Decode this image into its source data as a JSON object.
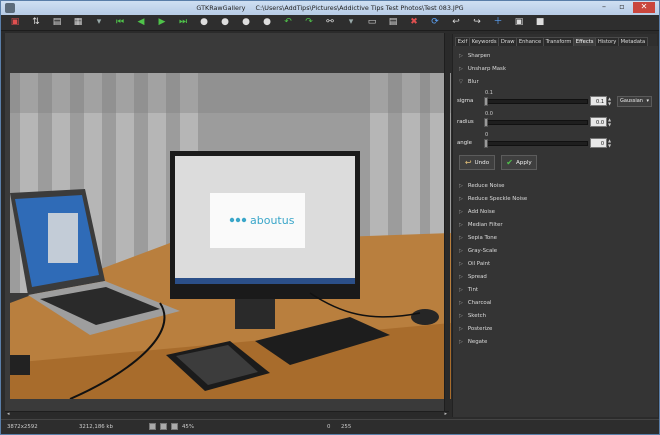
{
  "window": {
    "app_name": "GTKRawGallery",
    "file_path": "C:\\Users\\AddTips\\Pictures\\Addictive Tips Test Photos\\Test 083.JPG"
  },
  "toolbar": {
    "icons": [
      "photo-icon",
      "sort-icon",
      "print-icon",
      "layout-icon",
      "dropdown-icon",
      "first-icon",
      "prev-icon",
      "next-icon",
      "last-icon",
      "dot-icon",
      "dot-icon",
      "dot-icon",
      "dot-icon",
      "rotate-left-icon",
      "rotate-right-icon",
      "link-icon",
      "dropdown-icon",
      "page-icon",
      "doc-icon",
      "delete-icon",
      "refresh-icon",
      "undo-icon",
      "redo-icon",
      "add-icon",
      "image-icon",
      "stop-icon"
    ]
  },
  "photo": {
    "monitor_text": "aboutus"
  },
  "tabs": [
    "Exif",
    "Keywords",
    "Draw",
    "Enhance",
    "Transform",
    "Effects",
    "History",
    "Metadata"
  ],
  "active_tab": "Effects",
  "effects_top": [
    "Sharpen",
    "Unsharp Mask"
  ],
  "blur": {
    "label": "Blur",
    "sigma": {
      "label": "sigma",
      "value_above": "0.1",
      "value": "0.1"
    },
    "radius": {
      "label": "radius",
      "value_above": "0.0",
      "value": "0.0"
    },
    "angle": {
      "label": "angle",
      "value_above": "0",
      "value": "0"
    },
    "method": "Gaussian",
    "undo_label": "Undo",
    "apply_label": "Apply"
  },
  "effects_rest": [
    "Reduce Noise",
    "Reduce Speckle Noise",
    "Add Noise",
    "Median Filter",
    "Sepia Tone",
    "Gray-Scale",
    "Oil Paint",
    "Spread",
    "Tint",
    "Charcoal",
    "Sketch",
    "Posterize",
    "Negate"
  ],
  "status": {
    "dimensions": "3872x2592",
    "filesize": "3212,186 kb",
    "zoom": "45%",
    "left_value": "0",
    "right_value": "255"
  },
  "colors": {
    "accent_green": "#4fc34a",
    "close_red": "#c9463d",
    "title_bg": "#cfdff2"
  }
}
